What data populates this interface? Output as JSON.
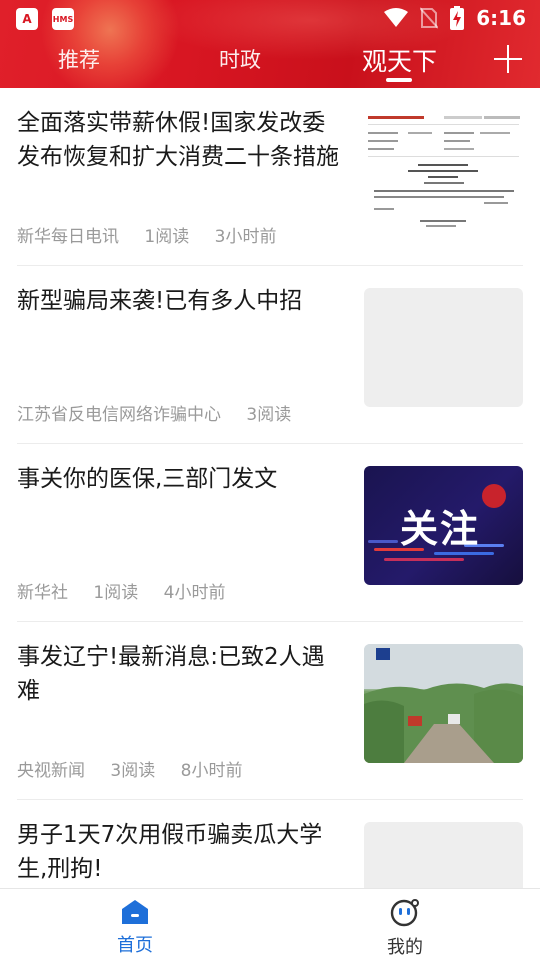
{
  "status_bar": {
    "time": "6:16",
    "app_icons": [
      "A",
      "HMS"
    ]
  },
  "header": {
    "tabs": [
      {
        "label": "推荐",
        "active": false
      },
      {
        "label": "时政",
        "active": false
      },
      {
        "label": "观天下",
        "active": true
      }
    ],
    "add_icon": "plus-icon",
    "accent_color": "#d81622"
  },
  "feed": [
    {
      "title": "全面落实带薪休假!国家发改委发布恢复和扩大消费二十条措施",
      "meta": [
        "新华每日电讯",
        "1阅读",
        "3小时前"
      ],
      "thumbnail": "document-scan"
    },
    {
      "title": "新型骗局来袭!已有多人中招",
      "meta": [
        "江苏省反电信网络诈骗中心",
        "3阅读"
      ],
      "thumbnail": "placeholder"
    },
    {
      "title": "事关你的医保,三部门发文",
      "meta": [
        "新华社",
        "1阅读",
        "4小时前"
      ],
      "thumbnail": "focus-graphic",
      "thumbnail_text": "关注"
    },
    {
      "title": "事发辽宁!最新消息:已致2人遇难",
      "meta": [
        "央视新闻",
        "3阅读",
        "8小时前"
      ],
      "thumbnail": "rural-road-photo"
    },
    {
      "title": "男子1天7次用假币骗卖瓜大学生,刑拘!",
      "meta": [],
      "thumbnail": "placeholder"
    }
  ],
  "bottom_nav": [
    {
      "label": "首页",
      "icon": "home-icon",
      "active": true
    },
    {
      "label": "我的",
      "icon": "profile-face-icon",
      "active": false
    }
  ]
}
